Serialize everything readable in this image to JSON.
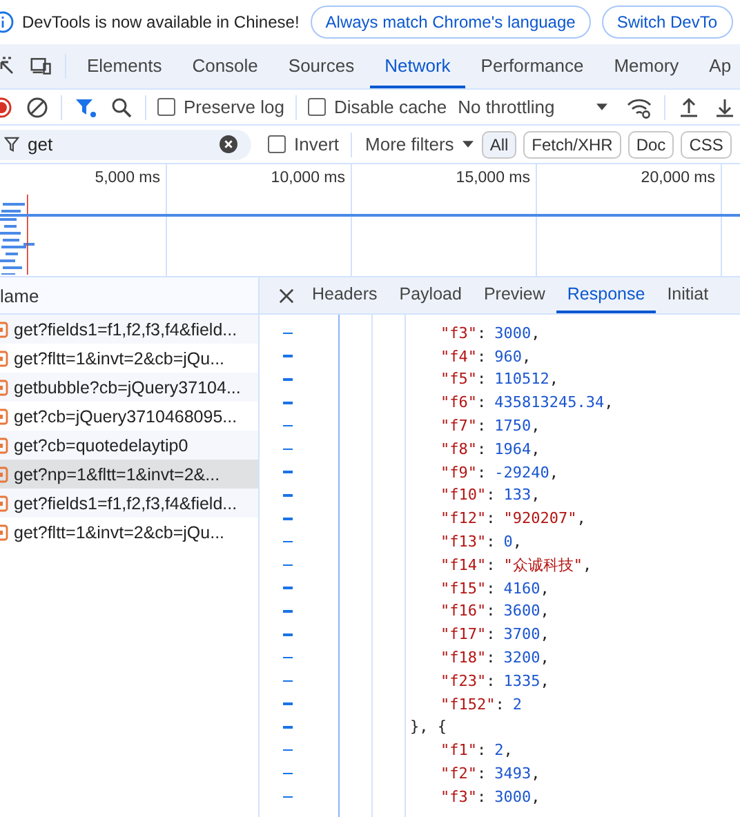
{
  "banner": {
    "message": "DevTools is now available in Chinese!",
    "buttons": [
      "Always match Chrome's language",
      "Switch DevTo"
    ]
  },
  "tabs": [
    {
      "label": "Elements",
      "selected": false
    },
    {
      "label": "Console",
      "selected": false
    },
    {
      "label": "Sources",
      "selected": false
    },
    {
      "label": "Network",
      "selected": true
    },
    {
      "label": "Performance",
      "selected": false
    },
    {
      "label": "Memory",
      "selected": false
    },
    {
      "label": "Ap",
      "selected": false
    }
  ],
  "toolbar": {
    "preserve_log": {
      "label": "Preserve log",
      "checked": false
    },
    "disable_cache": {
      "label": "Disable cache",
      "checked": false
    },
    "throttling": "No throttling"
  },
  "filter": {
    "value": "get",
    "invert": {
      "label": "Invert",
      "checked": false
    },
    "more_filters": "More filters",
    "chips": [
      {
        "label": "All",
        "selected": true
      },
      {
        "label": "Fetch/XHR",
        "selected": false
      },
      {
        "label": "Doc",
        "selected": false
      },
      {
        "label": "CSS",
        "selected": false
      }
    ]
  },
  "timeline": {
    "ticks": [
      "5,000 ms",
      "10,000 ms",
      "15,000 ms",
      "20,000 ms"
    ]
  },
  "requests": {
    "header": "lame",
    "rows": [
      {
        "name": "get?fields1=f1,f2,f3,f4&field...",
        "selected": false
      },
      {
        "name": "get?fltt=1&invt=2&cb=jQu...",
        "selected": false
      },
      {
        "name": "getbubble?cb=jQuery37104...",
        "selected": false
      },
      {
        "name": "get?cb=jQuery3710468095...",
        "selected": false
      },
      {
        "name": "get?cb=quotedelaytip0",
        "selected": false
      },
      {
        "name": "get?np=1&fltt=1&invt=2&...",
        "selected": true
      },
      {
        "name": "get?fields1=f1,f2,f3,f4&field...",
        "selected": false
      },
      {
        "name": "get?fltt=1&invt=2&cb=jQu...",
        "selected": false
      }
    ]
  },
  "detail_tabs": [
    {
      "label": "Headers",
      "selected": false
    },
    {
      "label": "Payload",
      "selected": false
    },
    {
      "label": "Preview",
      "selected": false
    },
    {
      "label": "Response",
      "selected": true
    },
    {
      "label": "Initiat",
      "selected": false
    }
  ],
  "response_lines": [
    {
      "kind": "number",
      "key": "\"f3\"",
      "sep": ":",
      "value": "3000",
      "tail": ","
    },
    {
      "kind": "number",
      "key": "\"f4\"",
      "sep": ":",
      "value": "960",
      "tail": ","
    },
    {
      "kind": "number",
      "key": "\"f5\"",
      "sep": ":",
      "value": "110512",
      "tail": ","
    },
    {
      "kind": "number",
      "key": "\"f6\"",
      "sep": ":",
      "value": "435813245.34",
      "tail": ","
    },
    {
      "kind": "number",
      "key": "\"f7\"",
      "sep": ":",
      "value": "1750",
      "tail": ","
    },
    {
      "kind": "number",
      "key": "\"f8\"",
      "sep": ":",
      "value": "1964",
      "tail": ","
    },
    {
      "kind": "number",
      "key": "\"f9\"",
      "sep": ":",
      "value": "-29240",
      "tail": ","
    },
    {
      "kind": "number",
      "key": "\"f10\"",
      "sep": ":",
      "value": "133",
      "tail": ","
    },
    {
      "kind": "string",
      "key": "\"f12\"",
      "sep": ":",
      "value": "\"920207\"",
      "tail": ","
    },
    {
      "kind": "number",
      "key": "\"f13\"",
      "sep": ":",
      "value": "0",
      "tail": ","
    },
    {
      "kind": "string",
      "key": "\"f14\"",
      "sep": ":",
      "value": "\"众诚科技\"",
      "tail": ","
    },
    {
      "kind": "number",
      "key": "\"f15\"",
      "sep": ":",
      "value": "4160",
      "tail": ","
    },
    {
      "kind": "number",
      "key": "\"f16\"",
      "sep": ":",
      "value": "3600",
      "tail": ","
    },
    {
      "kind": "number",
      "key": "\"f17\"",
      "sep": ":",
      "value": "3700",
      "tail": ","
    },
    {
      "kind": "number",
      "key": "\"f18\"",
      "sep": ":",
      "value": "3200",
      "tail": ","
    },
    {
      "kind": "number",
      "key": "\"f23\"",
      "sep": ":",
      "value": "1335",
      "tail": ","
    },
    {
      "kind": "number",
      "key": "\"f152\"",
      "sep": ":",
      "value": "2"
    },
    {
      "kind": "punct",
      "text": "}, {"
    },
    {
      "kind": "number",
      "key": "\"f1\"",
      "sep": ":",
      "value": "2",
      "tail": ","
    },
    {
      "kind": "number",
      "key": "\"f2\"",
      "sep": ":",
      "value": "3493",
      "tail": ","
    },
    {
      "kind": "number",
      "key": "\"f3\"",
      "sep": ":",
      "value": "3000",
      "tail": ","
    }
  ]
}
